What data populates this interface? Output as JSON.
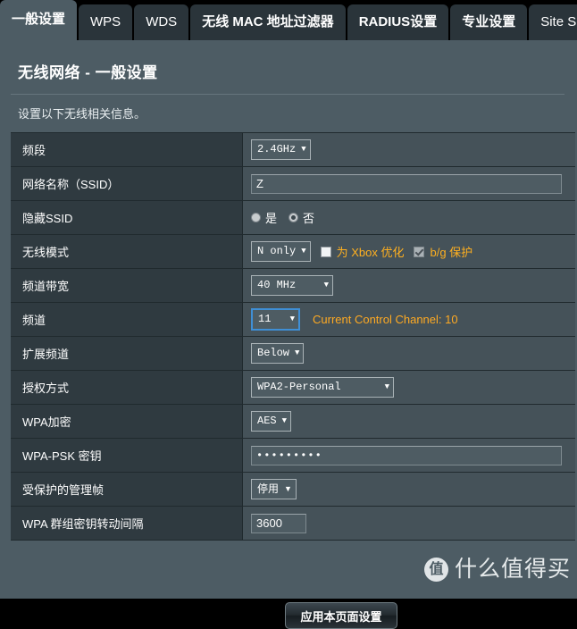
{
  "tabs": [
    {
      "label": "一般设置",
      "active": true,
      "cjk": true
    },
    {
      "label": "WPS",
      "active": false,
      "cjk": false
    },
    {
      "label": "WDS",
      "active": false,
      "cjk": false
    },
    {
      "label": "无线 MAC 地址过滤器",
      "active": false,
      "cjk": true
    },
    {
      "label": "RADIUS设置",
      "active": false,
      "cjk": true
    },
    {
      "label": "专业设置",
      "active": false,
      "cjk": true
    },
    {
      "label": "Site Survey",
      "active": false,
      "cjk": false
    }
  ],
  "page": {
    "title": "无线网络 - 一般设置",
    "description": "设置以下无线相关信息。"
  },
  "rows": {
    "band": {
      "label": "频段",
      "value": "2.4GHz"
    },
    "ssid": {
      "label": "网络名称（SSID）",
      "value": "Z"
    },
    "hide_ssid": {
      "label": "隐藏SSID",
      "yes_label": "是",
      "no_label": "否",
      "selected": "no"
    },
    "wireless_mode": {
      "label": "无线模式",
      "value": "N only",
      "xbox_label": "为 Xbox 优化",
      "xbox_checked": false,
      "bg_protect_label": "b/g 保护",
      "bg_protect_checked": true,
      "bg_protect_disabled": true
    },
    "bandwidth": {
      "label": "频道带宽",
      "value": "40 MHz"
    },
    "channel": {
      "label": "频道",
      "value": "11",
      "note": "Current Control Channel: 10",
      "focused": true
    },
    "ext_channel": {
      "label": "扩展频道",
      "value": "Below"
    },
    "auth_method": {
      "label": "授权方式",
      "value": "WPA2-Personal"
    },
    "wpa_encrypt": {
      "label": "WPA加密",
      "value": "AES"
    },
    "wpa_psk": {
      "label": "WPA-PSK 密钥",
      "value": "•••••••••"
    },
    "pmf": {
      "label": "受保护的管理帧",
      "value": "停用"
    },
    "group_key_interval": {
      "label": "WPA 群组密钥转动间隔",
      "value": "3600"
    }
  },
  "footer": {
    "apply_label": "应用本页面设置"
  },
  "watermark": {
    "logo_char": "值",
    "text": "什么值得买"
  },
  "colors": {
    "page_bg": "#4d5c64",
    "tab_inactive": "#2a343a",
    "tab_active": "#4d5c64",
    "label_cell": "#2f3a40",
    "value_cell": "#455259",
    "accent_orange": "#ffaa22",
    "focus_blue": "#3f8fd6"
  }
}
